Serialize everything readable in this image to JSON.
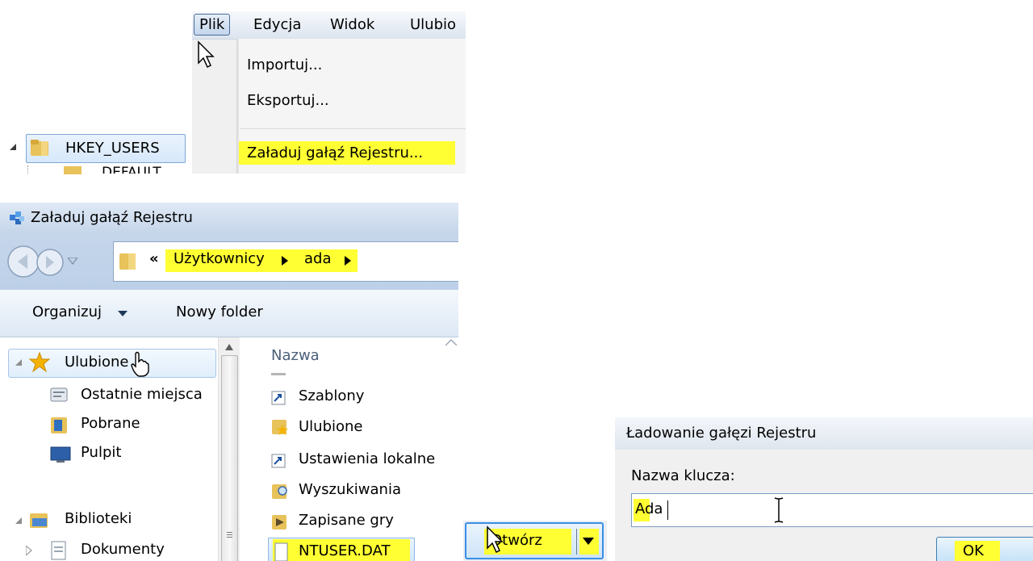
{
  "registry_menu": {
    "menubar": [
      "Plik",
      "Edycja",
      "Widok",
      "Ulubio"
    ],
    "items": [
      "Importuj...",
      "Eksportuj...",
      "Załaduj gałąź Rejestru..."
    ],
    "tree_node": "HKEY_USERS",
    "tree_child_partial": "DEFAULT"
  },
  "open_dialog": {
    "title": "Załaduj gałąź Rejestru",
    "breadcrumb_prefix": "«",
    "breadcrumb": [
      "Użytkownicy",
      "ada"
    ],
    "toolbar": {
      "organize": "Organizuj",
      "new_folder": "Nowy folder"
    },
    "nav": {
      "favorites": "Ulubione",
      "favorites_items": [
        "Ostatnie miejsca",
        "Pobrane",
        "Pulpit"
      ],
      "libraries": "Biblioteki",
      "libraries_items": [
        "Dokumenty"
      ]
    },
    "column_header": "Nazwa",
    "files": [
      "Szablony",
      "Ulubione",
      "Ustawienia lokalne",
      "Wyszukiwania",
      "Zapisane gry",
      "NTUSER.DAT"
    ]
  },
  "open_button": {
    "label": "Otwórz"
  },
  "load_dialog": {
    "title": "Ładowanie gałęzi Rejestru",
    "field_label": "Nazwa klucza:",
    "field_value": "Ada",
    "ok_label": "OK"
  },
  "colors": {
    "highlight": "#ffff33",
    "chrome_blue": "#c5d6ea",
    "selection": "#cce8ff"
  }
}
